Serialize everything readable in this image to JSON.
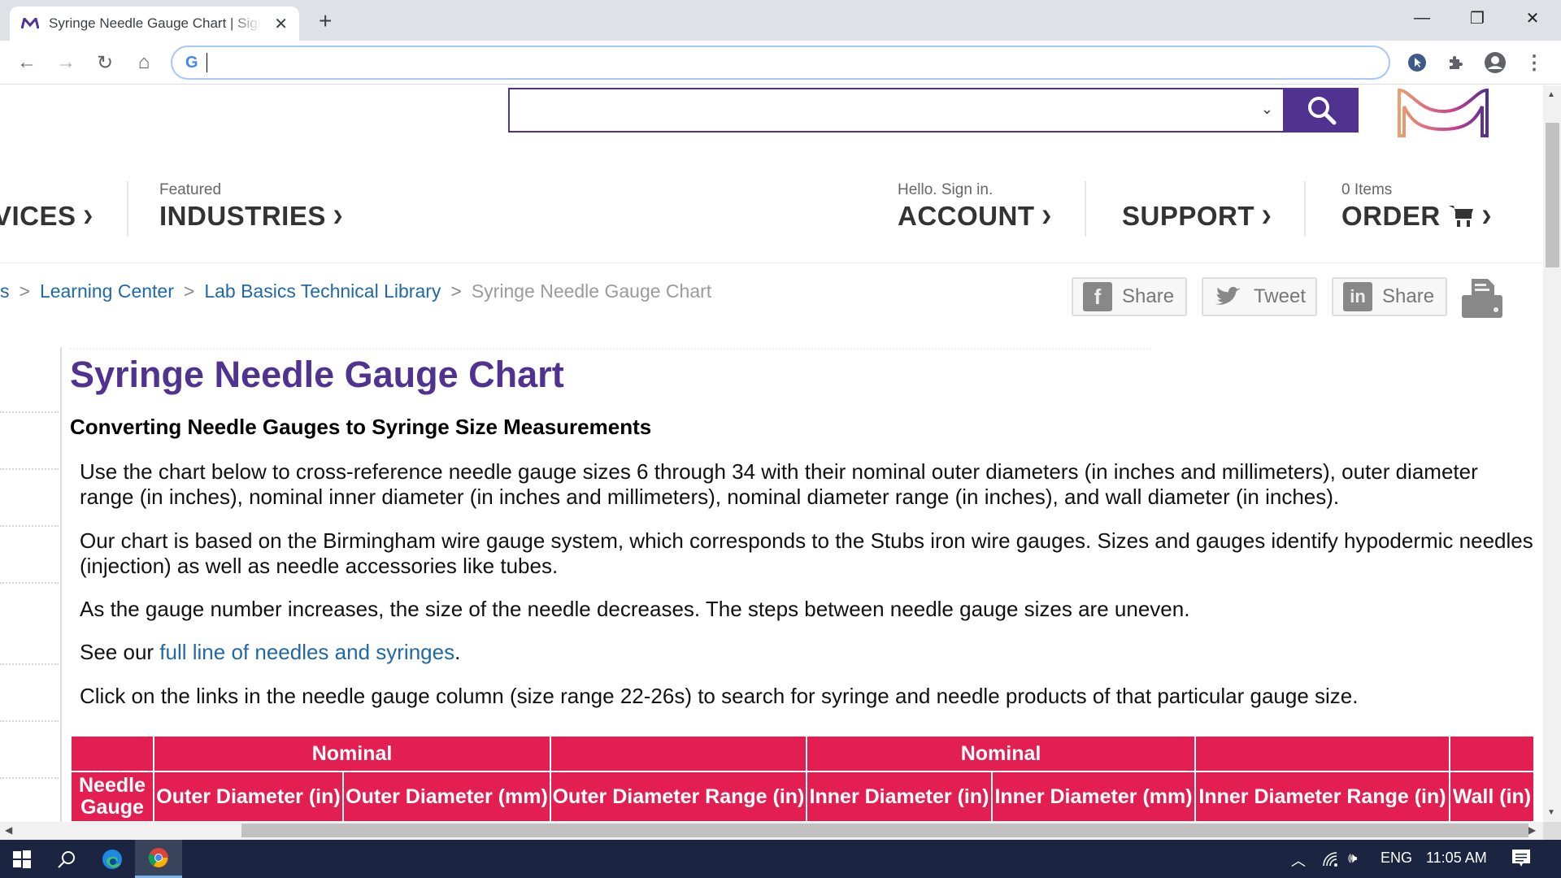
{
  "browser": {
    "tab_title": "Syringe Needle Gauge Chart | Sigma-Aldrich",
    "tab_favicon": "merck-m-icon",
    "new_tab_label": "+",
    "address_value": "",
    "window_controls": {
      "minimize": "—",
      "restore": "❐",
      "close": "✕"
    },
    "nav": {
      "back": "←",
      "forward": "→",
      "reload": "↻",
      "home": "⌂"
    },
    "toolbar_icons": [
      "cursor-extension-icon",
      "extensions-puzzle-icon",
      "profile-icon",
      "menu-kebab-icon"
    ]
  },
  "site": {
    "search": {
      "value": "",
      "dropdown_chevron": "⌄",
      "button_icon": "search-icon"
    },
    "brand_color": "#503291",
    "nav": [
      {
        "small": "",
        "label": "VICES",
        "chevron": "⌄"
      },
      {
        "small": "Featured",
        "label": "INDUSTRIES",
        "chevron": "⌄"
      },
      {
        "small": "Hello. Sign in.",
        "label": "ACCOUNT",
        "chevron": "⌄"
      },
      {
        "small": "",
        "label": "SUPPORT",
        "chevron": "⌄"
      },
      {
        "small": "0 Items",
        "label": "ORDER",
        "chevron": "⌄"
      }
    ],
    "breadcrumb": {
      "items": [
        "s",
        "Learning Center",
        "Lab Basics Technical Library"
      ],
      "current": "Syringe Needle Gauge Chart",
      "separator": ">"
    },
    "share": {
      "facebook": {
        "icon": "f",
        "label": "Share"
      },
      "twitter": {
        "label": "Tweet"
      },
      "linkedin": {
        "icon": "in",
        "label": "Share"
      }
    }
  },
  "article": {
    "title": "Syringe Needle Gauge Chart",
    "subtitle": "Converting Needle Gauges to Syringe Size Measurements",
    "p1": "Use the chart below to cross-reference needle gauge sizes 6 through 34 with their nominal outer diameters (in inches and millimeters), outer diameter range (in inches), nominal inner diameter (in inches and millimeters), nominal diameter range (in inches), and wall diameter (in inches).",
    "p2": "Our chart is based on the Birmingham wire gauge system, which corresponds to the Stubs iron wire gauges. Sizes and gauges identify hypodermic needles (injection) as well as needle accessories like tubes.",
    "p3": "As the gauge number increases, the size of the needle decreases. The steps between needle gauge sizes are uneven.",
    "p4_prefix": "See our ",
    "p4_link": "full line of needles and syringes",
    "p4_suffix": ".",
    "p5": "Click on the links in the needle gauge column (size range 22-26s) to search for syringe and needle products of that particular gauge size.",
    "table": {
      "header_color": "#e31f52",
      "group_row": [
        "",
        "Nominal",
        "",
        "Nominal",
        "",
        ""
      ],
      "columns": [
        "Needle Gauge",
        "Outer Diameter (in)",
        "Outer Diameter (mm)",
        "Outer Diameter Range (in)",
        "Inner Diameter (in)",
        "Inner Diameter (mm)",
        "Inner Diameter Range (in)",
        "Wall (in)"
      ]
    }
  },
  "taskbar": {
    "tray": {
      "lang": "ENG",
      "time": "11:05 AM"
    }
  }
}
